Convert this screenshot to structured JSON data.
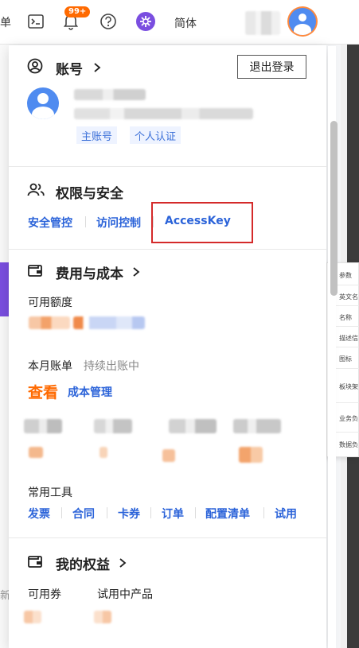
{
  "topbar": {
    "edge_text": "单",
    "notification_badge": "99+",
    "language": "简体",
    "icons": [
      "terminal-icon",
      "bell-icon",
      "help-icon",
      "app-launcher-icon"
    ]
  },
  "account": {
    "title": "账号",
    "logout_label": "退出登录",
    "tags": [
      "主账号",
      "个人认证"
    ]
  },
  "security": {
    "title": "权限与安全",
    "links": [
      "安全管控",
      "访问控制",
      "AccessKey"
    ]
  },
  "billing": {
    "title": "费用与成本",
    "available_label": "可用额度",
    "monthly_bill_label": "本月账单",
    "monthly_bill_status": "持续出账中",
    "view_label": "查看",
    "cost_mgmt_label": "成本管理",
    "tools_label": "常用工具",
    "tools": [
      "发票",
      "合同",
      "卡券",
      "订单",
      "配置清单",
      "试用"
    ]
  },
  "benefits": {
    "title": "我的权益",
    "coupons_label": "可用券",
    "trial_label": "试用中产品"
  },
  "background_table": {
    "cells": [
      "参数",
      "英文名",
      "名称",
      "描述信",
      "图标",
      "板块架",
      "业务负",
      "数据负"
    ]
  },
  "left_edge_text": "新",
  "colors": {
    "accent_orange": "#ff6a00",
    "link_blue": "#2b63d9",
    "highlight_red": "#d42a2a"
  }
}
